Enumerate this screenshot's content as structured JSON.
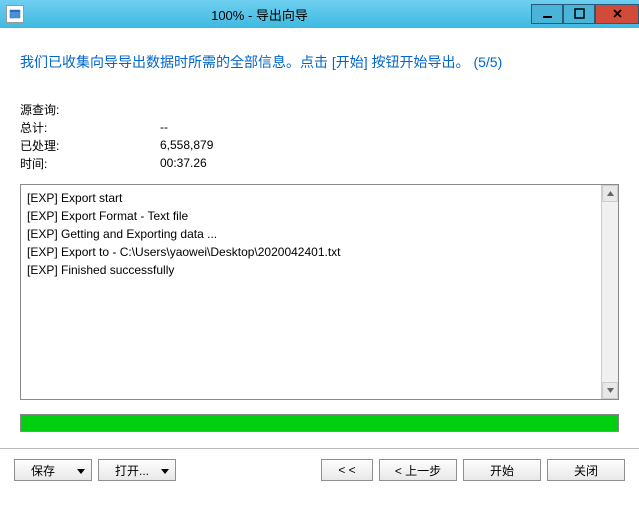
{
  "titlebar": {
    "title": "100% - 导出向导"
  },
  "heading": "我们已收集向导导出数据时所需的全部信息。点击 [开始] 按钮开始导出。 (5/5)",
  "stats": {
    "source_query_label": "源查询:",
    "source_query_value": "",
    "total_label": "总计:",
    "total_value": "--",
    "processed_label": "已处理:",
    "processed_value": "6,558,879",
    "time_label": "时间:",
    "time_value": "00:37.26"
  },
  "log": [
    "[EXP] Export start",
    "[EXP] Export Format - Text file",
    "[EXP] Getting and Exporting data ...",
    "[EXP] Export to - C:\\Users\\yaowei\\Desktop\\2020042401.txt",
    "[EXP] Finished successfully"
  ],
  "buttons": {
    "save": "保存",
    "open": "打开...",
    "first": "< <",
    "prev": "< 上一步",
    "start": "开始",
    "close": "关闭"
  }
}
